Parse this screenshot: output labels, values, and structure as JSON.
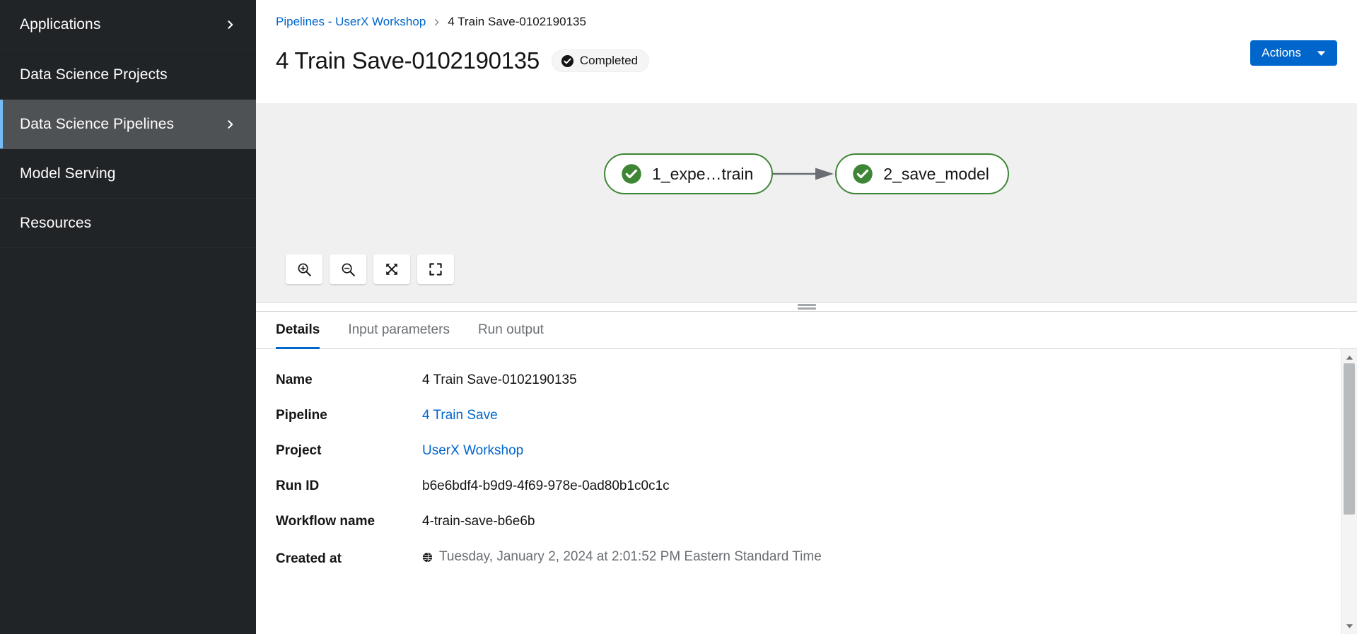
{
  "sidebar": {
    "items": [
      {
        "label": "Applications",
        "icon": "chevron-right-icon",
        "has_chevron": true,
        "active": false
      },
      {
        "label": "Data Science Projects",
        "icon": "",
        "has_chevron": false,
        "active": false
      },
      {
        "label": "Data Science Pipelines",
        "icon": "chevron-right-icon",
        "has_chevron": true,
        "active": true
      },
      {
        "label": "Model Serving",
        "icon": "",
        "has_chevron": false,
        "active": false
      },
      {
        "label": "Resources",
        "icon": "",
        "has_chevron": false,
        "active": false
      }
    ]
  },
  "header": {
    "breadcrumb": {
      "parent": "Pipelines - UserX Workshop",
      "separator": "chevron-right-icon",
      "current": "4 Train Save-0102190135"
    },
    "title": "4 Train Save-0102190135",
    "status": {
      "label": "Completed",
      "icon": "check-circle-icon",
      "color": "#151515"
    },
    "actions_button": {
      "label": "Actions",
      "icon": "caret-down-icon",
      "color": "#0066CC"
    }
  },
  "graph": {
    "nodes": [
      {
        "label": "1_expe…train",
        "status_icon": "check-circle-green-icon",
        "color": "#3E8635"
      },
      {
        "label": "2_save_model",
        "status_icon": "check-circle-green-icon",
        "color": "#3E8635"
      }
    ],
    "edge": {
      "from": "1_expe…train",
      "to": "2_save_model",
      "arrow": "arrow-right-icon",
      "color": "#6A6E73"
    },
    "toolbar": [
      {
        "name": "zoom-in",
        "icon": "magnifier-plus-icon"
      },
      {
        "name": "zoom-out",
        "icon": "magnifier-minus-icon"
      },
      {
        "name": "fit-to-screen",
        "icon": "expand-arrows-icon"
      },
      {
        "name": "reset-view",
        "icon": "corner-brackets-icon"
      }
    ]
  },
  "tabs": [
    {
      "label": "Details",
      "active": true
    },
    {
      "label": "Input parameters",
      "active": false
    },
    {
      "label": "Run output",
      "active": false
    }
  ],
  "details": {
    "rows": [
      {
        "label": "Name",
        "value": "4 Train Save-0102190135",
        "type": "text"
      },
      {
        "label": "Pipeline",
        "value": "4 Train Save",
        "type": "link"
      },
      {
        "label": "Project",
        "value": "UserX Workshop",
        "type": "link"
      },
      {
        "label": "Run ID",
        "value": "b6e6bdf4-b9d9-4f69-978e-0ad80b1c0c1c",
        "type": "text"
      },
      {
        "label": "Workflow name",
        "value": "4-train-save-b6e6b",
        "type": "text"
      },
      {
        "label": "Created at",
        "value": "Tuesday, January 2, 2024 at 2:01:52 PM Eastern Standard Time",
        "type": "timestamp",
        "icon": "globe-icon"
      }
    ]
  }
}
